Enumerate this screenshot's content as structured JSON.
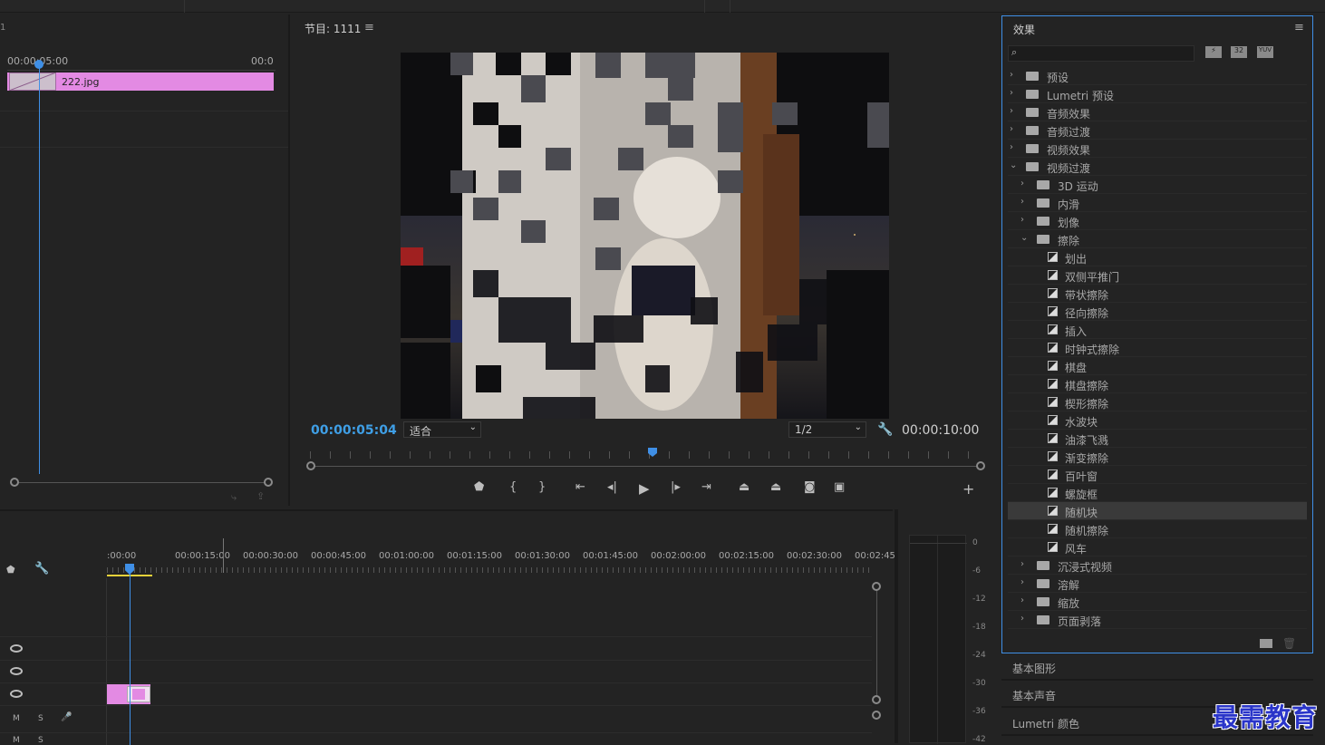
{
  "source_panel": {
    "corner_label": "1",
    "timecode_left": "00:00:05:00",
    "timecode_right": "00:0",
    "clip_name": "222.jpg"
  },
  "program": {
    "title": "节目: 1111",
    "current_time": "00:00:05:04",
    "fit_label": "适合",
    "resolution_label": "1/2",
    "duration": "00:00:10:00"
  },
  "effects_panel": {
    "title": "效果",
    "search_placeholder": "",
    "filter_icons": [
      "accelerated-icon",
      "32bit-icon",
      "yuv-icon"
    ],
    "tree": [
      {
        "label": "预设",
        "level": 0,
        "kind": "preset-folder",
        "open": false
      },
      {
        "label": "Lumetri 预设",
        "level": 0,
        "kind": "preset-folder",
        "open": false
      },
      {
        "label": "音频效果",
        "level": 0,
        "kind": "folder",
        "open": false
      },
      {
        "label": "音频过渡",
        "level": 0,
        "kind": "folder",
        "open": false
      },
      {
        "label": "视频效果",
        "level": 0,
        "kind": "folder",
        "open": false
      },
      {
        "label": "视频过渡",
        "level": 0,
        "kind": "folder",
        "open": true
      },
      {
        "label": "3D 运动",
        "level": 1,
        "kind": "folder",
        "open": false
      },
      {
        "label": "内滑",
        "level": 1,
        "kind": "folder",
        "open": false
      },
      {
        "label": "划像",
        "level": 1,
        "kind": "folder",
        "open": false
      },
      {
        "label": "擦除",
        "level": 1,
        "kind": "folder",
        "open": true
      },
      {
        "label": "划出",
        "level": 2,
        "kind": "effect"
      },
      {
        "label": "双侧平推门",
        "level": 2,
        "kind": "effect"
      },
      {
        "label": "带状擦除",
        "level": 2,
        "kind": "effect"
      },
      {
        "label": "径向擦除",
        "level": 2,
        "kind": "effect"
      },
      {
        "label": "插入",
        "level": 2,
        "kind": "effect"
      },
      {
        "label": "时钟式擦除",
        "level": 2,
        "kind": "effect"
      },
      {
        "label": "棋盘",
        "level": 2,
        "kind": "effect"
      },
      {
        "label": "棋盘擦除",
        "level": 2,
        "kind": "effect"
      },
      {
        "label": "楔形擦除",
        "level": 2,
        "kind": "effect"
      },
      {
        "label": "水波块",
        "level": 2,
        "kind": "effect"
      },
      {
        "label": "油漆飞溅",
        "level": 2,
        "kind": "effect"
      },
      {
        "label": "渐变擦除",
        "level": 2,
        "kind": "effect"
      },
      {
        "label": "百叶窗",
        "level": 2,
        "kind": "effect"
      },
      {
        "label": "螺旋框",
        "level": 2,
        "kind": "effect"
      },
      {
        "label": "随机块",
        "level": 2,
        "kind": "effect",
        "selected": true
      },
      {
        "label": "随机擦除",
        "level": 2,
        "kind": "effect"
      },
      {
        "label": "风车",
        "level": 2,
        "kind": "effect"
      },
      {
        "label": "沉浸式视频",
        "level": 1,
        "kind": "folder",
        "open": false
      },
      {
        "label": "溶解",
        "level": 1,
        "kind": "folder",
        "open": false
      },
      {
        "label": "缩放",
        "level": 1,
        "kind": "folder",
        "open": false
      },
      {
        "label": "页面剥落",
        "level": 1,
        "kind": "folder",
        "open": false
      }
    ]
  },
  "bottom_tabs": [
    "基本图形",
    "基本声音",
    "Lumetri 颜色"
  ],
  "timeline": {
    "ruler_labels": [
      ":00:00",
      "00:00:15:00",
      "00:00:30:00",
      "00:00:45:00",
      "00:01:00:00",
      "00:01:15:00",
      "00:01:30:00",
      "00:01:45:00",
      "00:02:00:00",
      "00:02:15:00",
      "00:02:30:00",
      "00:02:45:"
    ],
    "track_m": "M",
    "track_s": "S"
  },
  "meter_labels": [
    "0",
    "-6",
    "-12",
    "-18",
    "-24",
    "-30",
    "-36",
    "-42"
  ],
  "watermark": "最需教育",
  "colors": {
    "accent": "#3f8fe6",
    "clip": "#e38ae3",
    "panel": "#232323"
  }
}
